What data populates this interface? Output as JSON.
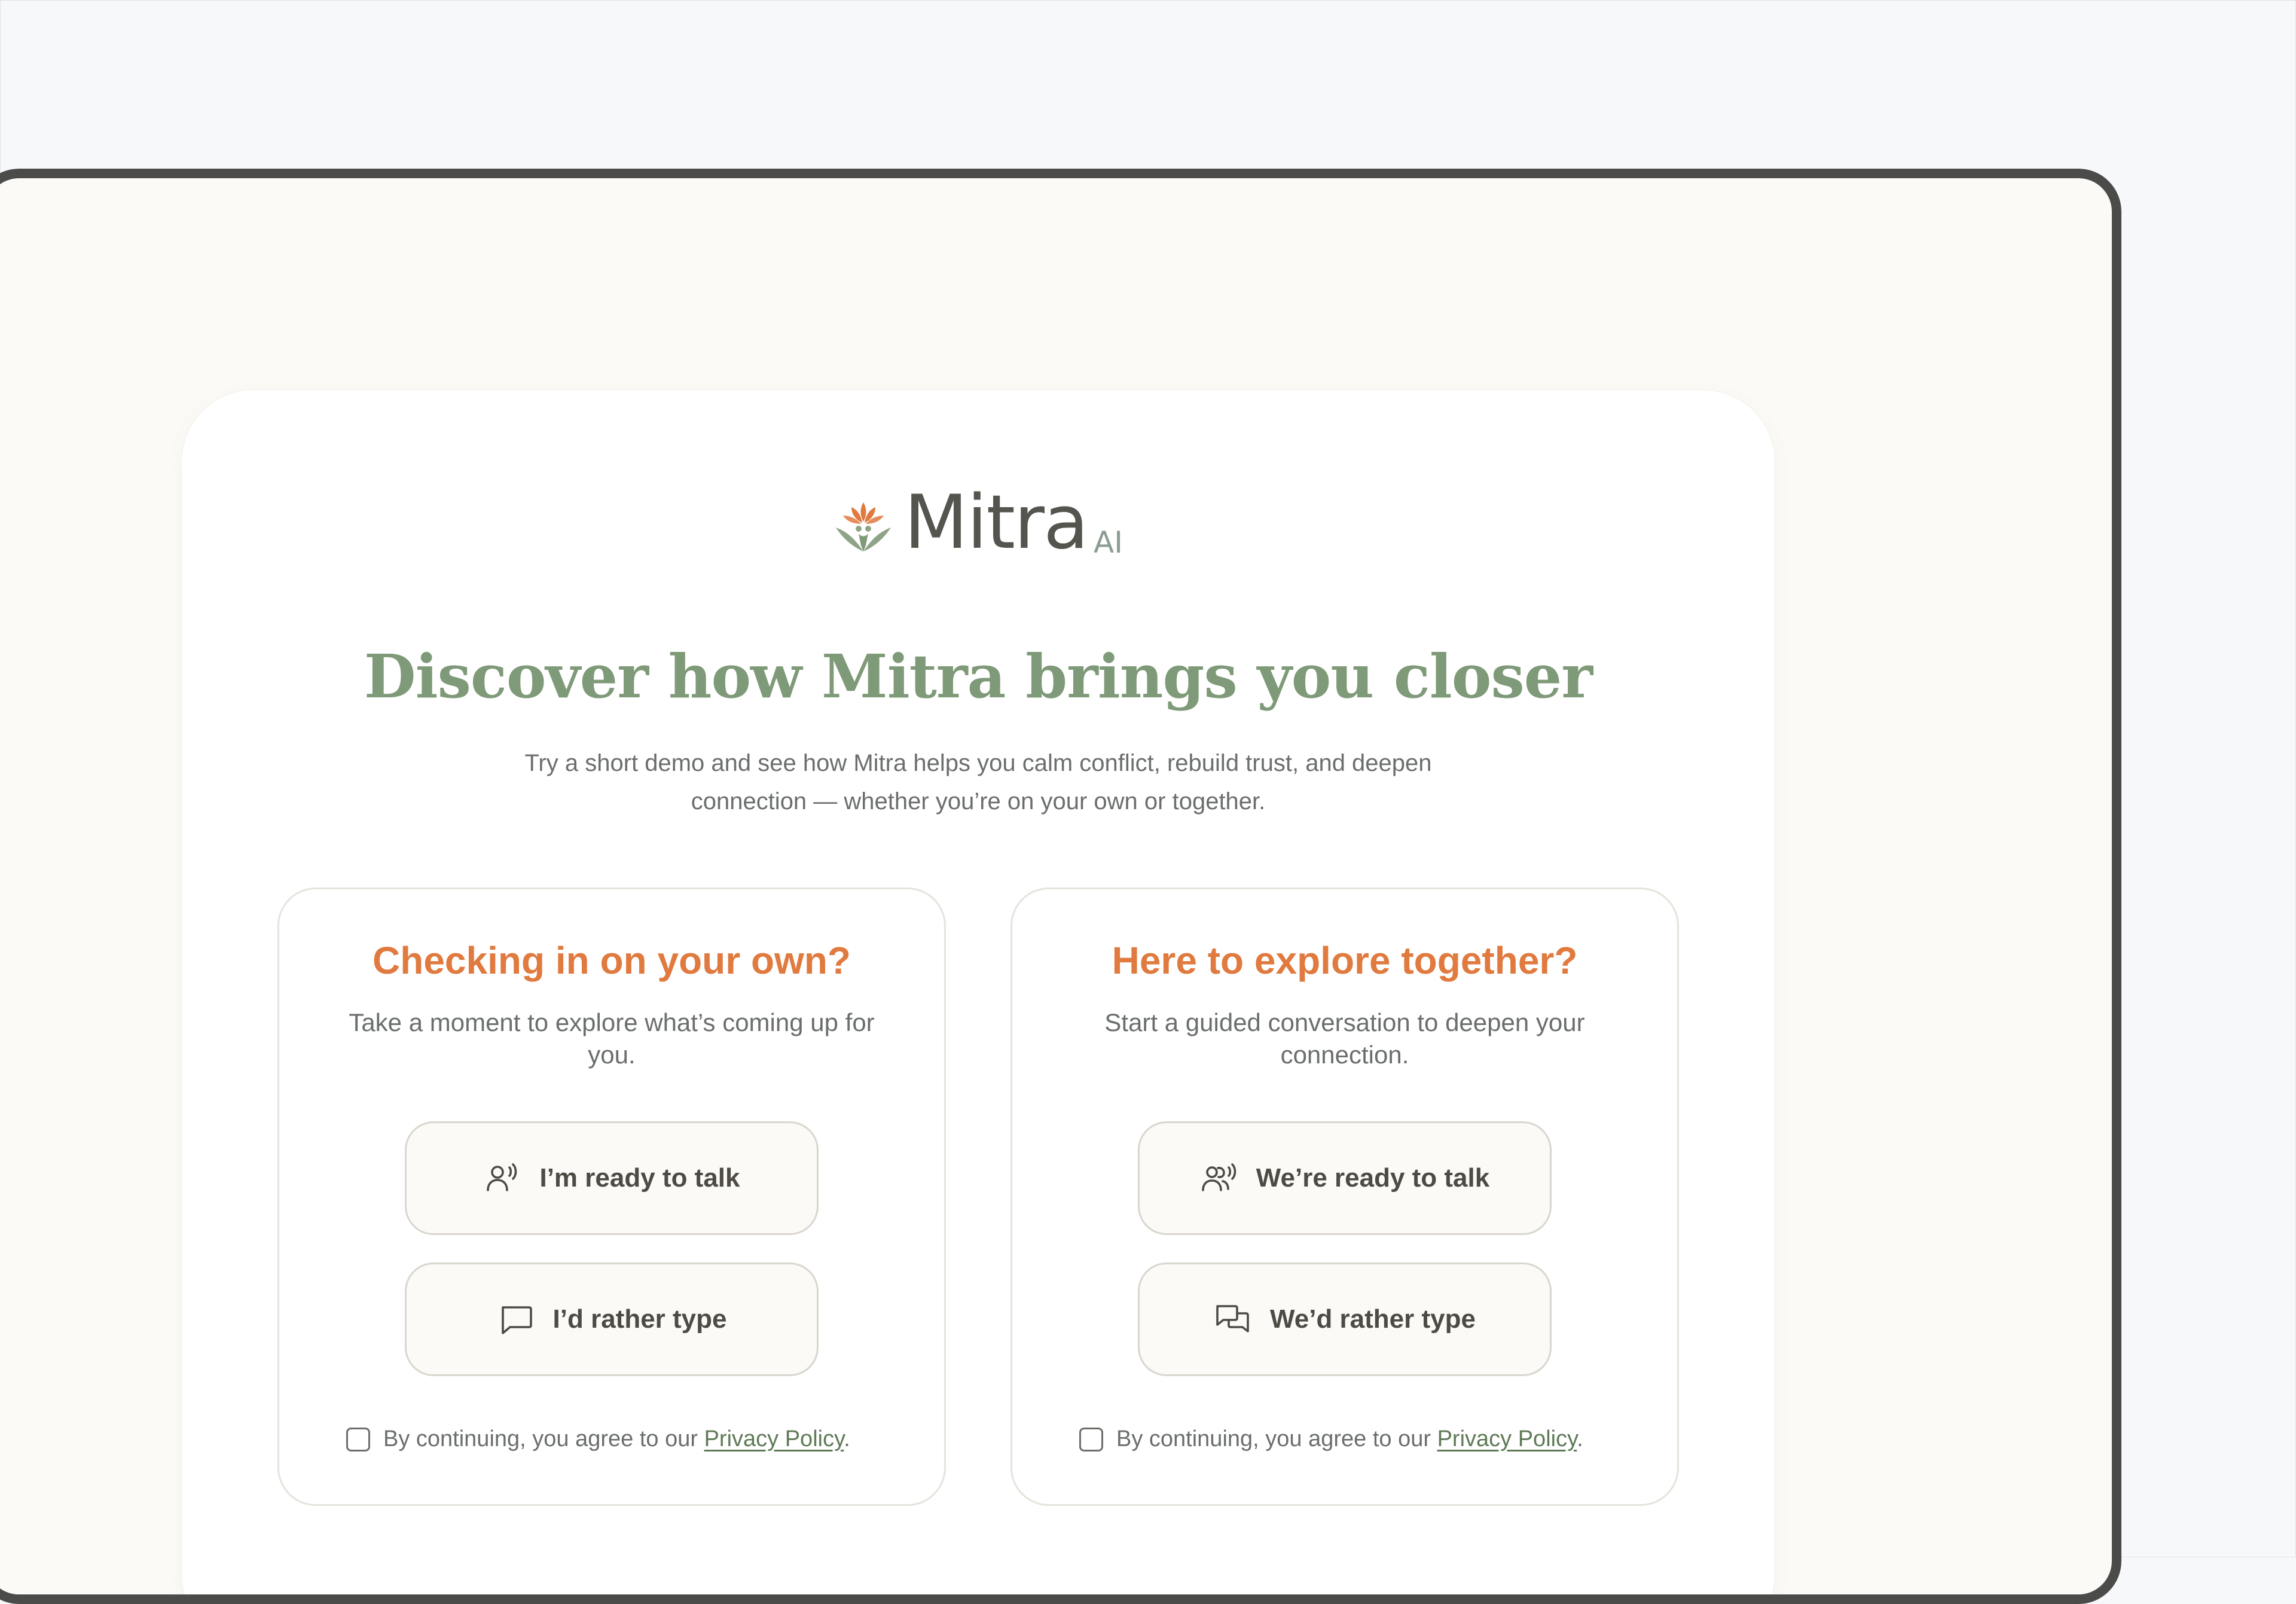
{
  "brand": {
    "name": "Mitra",
    "suffix": "AI",
    "logo_icon": "lotus-hands-icon"
  },
  "hero": {
    "title": "Discover how Mitra brings you closer",
    "subtitle": "Try a short demo and see how Mitra helps you calm conflict, rebuild trust, and deepen connection — whether you’re on your own or together."
  },
  "options": {
    "solo": {
      "title": "Checking in on your own?",
      "description": "Take a moment to explore what’s coming up for you.",
      "talk_label": "I’m ready to talk",
      "talk_icon": "person-speaking-icon",
      "type_label": "I’d rather type",
      "type_icon": "chat-bubble-icon",
      "consent_prefix": "By continuing, you agree to our ",
      "consent_link": "Privacy Policy",
      "consent_suffix": "."
    },
    "together": {
      "title": "Here to explore together?",
      "description": "Start a guided conversation to deepen your connection.",
      "talk_label": "We’re ready to talk",
      "talk_icon": "two-people-speaking-icon",
      "type_label": "We’d rather type",
      "type_icon": "chat-bubbles-icon",
      "consent_prefix": "By continuing, you agree to our ",
      "consent_link": "Privacy Policy",
      "consent_suffix": "."
    }
  },
  "colors": {
    "accent_orange": "#e07a3f",
    "brand_green": "#7f9a78",
    "link_green": "#5f7a57",
    "frame": "#4b4b49",
    "background": "#fbfaf6"
  }
}
